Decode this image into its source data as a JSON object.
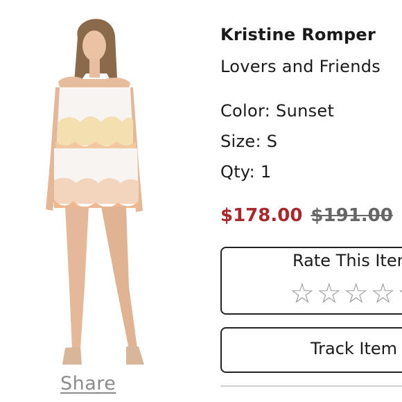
{
  "product": {
    "title": "Kristine Romper",
    "brand": "Lovers and Friends",
    "color": "Color: Sunset",
    "size": "Size: S",
    "qty": "Qty: 1",
    "price_sale": "$178.00",
    "price_original": "$191.00",
    "sale_color": "#a8282e"
  },
  "rating": {
    "label": "Rate This Item",
    "stars": [
      "☆",
      "☆",
      "☆",
      "☆",
      "☆"
    ],
    "icon": "star-outline-icon"
  },
  "actions": {
    "track_label": "Track Item",
    "share_label": "Share"
  }
}
